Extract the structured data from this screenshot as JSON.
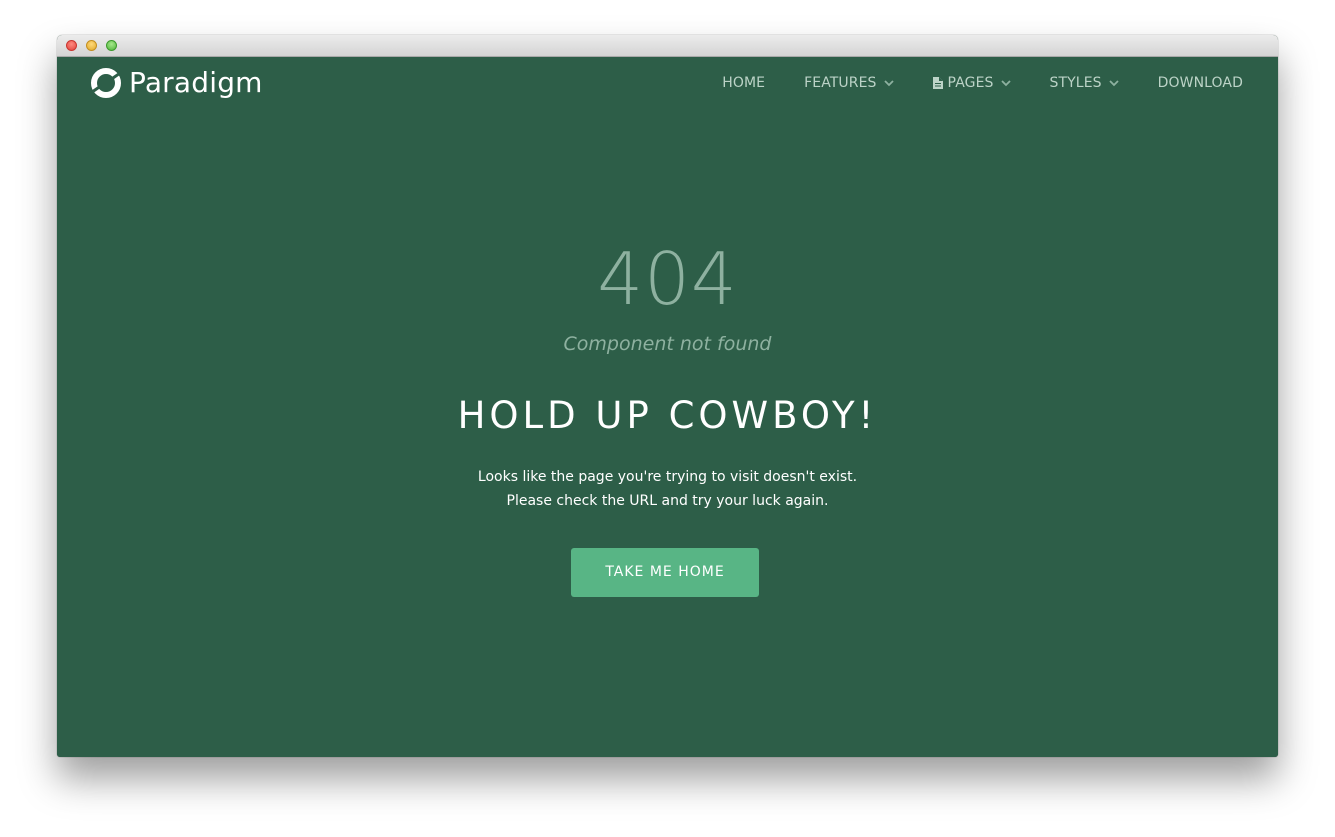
{
  "navbar": {
    "brand": "Paradigm",
    "items": [
      {
        "label": "HOME",
        "dropdown": false
      },
      {
        "label": "FEATURES",
        "dropdown": true
      },
      {
        "label": "PAGES",
        "dropdown": true,
        "icon": "document-icon"
      },
      {
        "label": "STYLES",
        "dropdown": true
      },
      {
        "label": "DOWNLOAD",
        "dropdown": false
      }
    ]
  },
  "error": {
    "code": "404",
    "subtitle": "Component not found",
    "heading": "HOLD UP COWBOY!",
    "description_line1": "Looks like the page you're trying to visit doesn't exist.",
    "description_line2": "Please check the URL and try your luck again.",
    "button_label": "TAKE ME HOME"
  },
  "colors": {
    "background": "#2d5e48",
    "accent": "#58b585",
    "muted_text": "#8eb1a0",
    "nav_text": "#bcd3c7"
  }
}
